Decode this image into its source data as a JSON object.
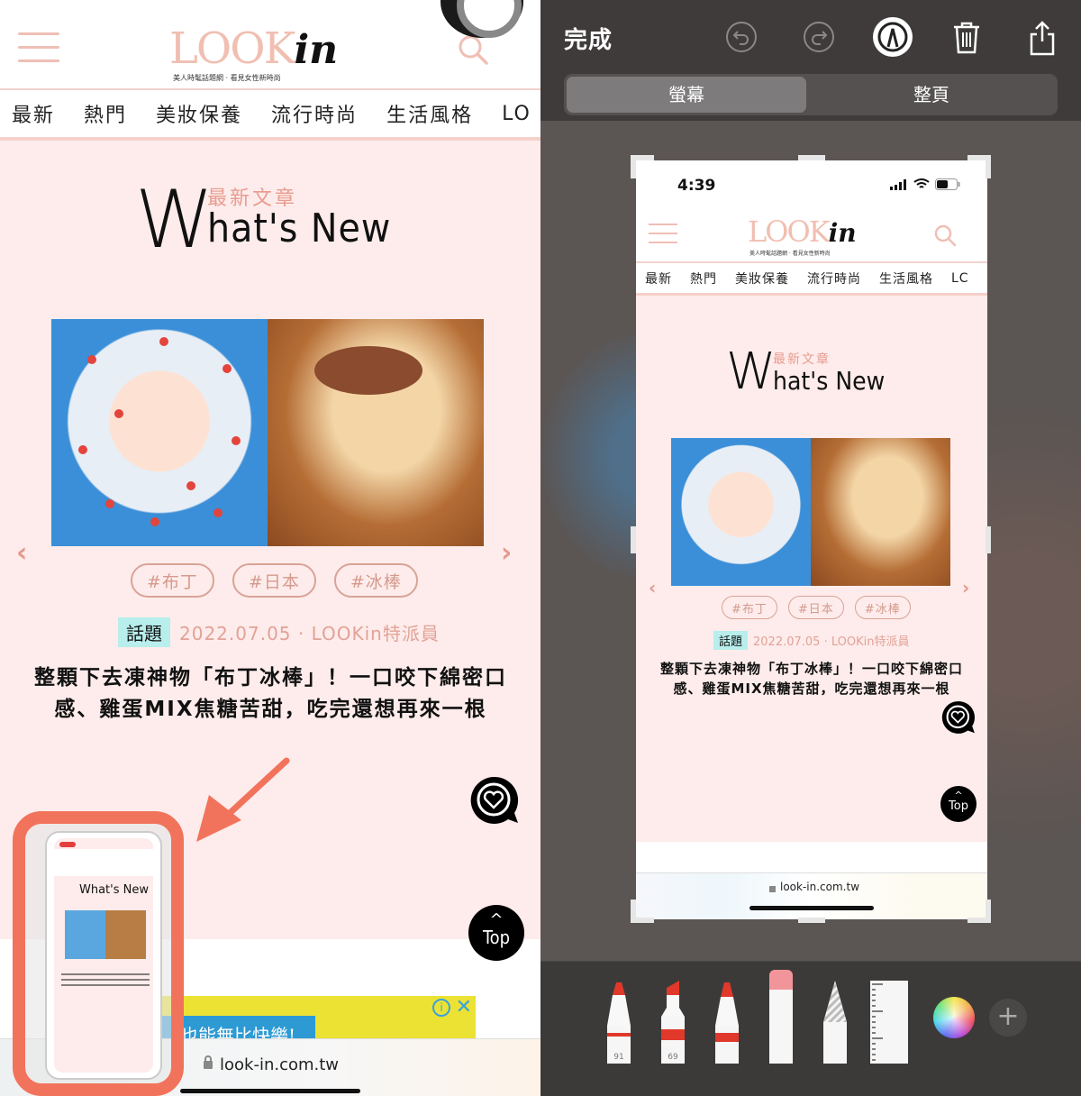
{
  "left": {
    "site": {
      "logo_look": "LOOK",
      "logo_in": "in",
      "tagline": "美人時髦話題網 · 看見女性新時尚",
      "nav": [
        "最新",
        "熱門",
        "美妝保養",
        "流行時尚",
        "生活風格",
        "LO"
      ]
    },
    "section": {
      "title_initial": "W",
      "title_rest": "hat's New",
      "title_zh": "最新文章"
    },
    "article": {
      "tags": [
        "#布丁",
        "#日本",
        "#冰棒"
      ],
      "category": "話題",
      "meta": "2022.07.05 · LOOKin特派員",
      "headline": "整顆下去凍神物「布丁冰棒」！一口咬下綿密口感、雞蛋MIX焦糖苦甜，吃完還想再來一根"
    },
    "floating": {
      "top_label": "Top",
      "top_chevron": "^"
    },
    "ad": {
      "text": "也能無比快樂!",
      "info_icon": "i",
      "close_icon": "✕"
    },
    "address_bar": {
      "url": "look-in.com.tw"
    },
    "thumbnail": {
      "title": "What's New"
    }
  },
  "right": {
    "topbar": {
      "done_label": "完成",
      "segments": [
        {
          "label": "螢幕",
          "selected": true
        },
        {
          "label": "整頁",
          "selected": false
        }
      ]
    },
    "preview": {
      "status_time": "4:39",
      "site": {
        "logo_look": "LOOK",
        "logo_in": "in",
        "tagline": "美人時髦話題網 · 看見女性新時尚",
        "nav": [
          "最新",
          "熱門",
          "美妝保養",
          "流行時尚",
          "生活風格",
          "LC"
        ]
      },
      "section": {
        "title_initial": "W",
        "title_rest": "hat's New",
        "title_zh": "最新文章"
      },
      "article": {
        "tags": [
          "#布丁",
          "#日本",
          "#冰棒"
        ],
        "category": "話題",
        "meta": "2022.07.05 · LOOKin特派員",
        "headline": "整顆下去凍神物「布丁冰棒」！一口咬下綿密口感、雞蛋MIX焦糖苦甜，吃完還想再來一根"
      },
      "floating": {
        "top_label": "Top",
        "top_chevron": "^"
      },
      "url": "look-in.com.tw"
    },
    "tools": {
      "pen_width": "91",
      "marker_width": "69",
      "plus_label": "+"
    }
  },
  "colors": {
    "accent_pink": "#f0bfb1",
    "page_bg": "#fdeceb",
    "tag_border": "#d9a397",
    "category_bg": "#b8eeec",
    "highlight_frame": "#f2735c",
    "markup_tool_red": "#e0392b"
  }
}
